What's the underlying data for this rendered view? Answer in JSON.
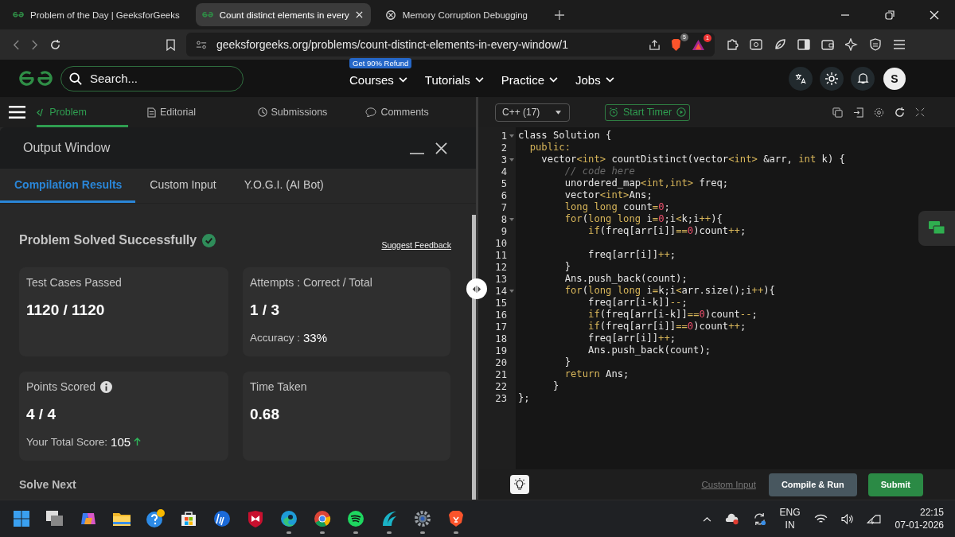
{
  "browser": {
    "tabs": [
      {
        "title": "Problem of the Day | GeeksforGeeks",
        "selected": false
      },
      {
        "title": "Count distinct elements in every",
        "selected": true
      },
      {
        "title": "Memory Corruption Debugging",
        "selected": false
      }
    ],
    "url": "geeksforgeeks.org/problems/count-distinct-elements-in-every-window/1",
    "shield_count": "5",
    "alert_count": "1"
  },
  "site_header": {
    "search": {
      "placeholder": "Search..."
    },
    "promo_badge": "Get 90% Refund",
    "nav": [
      "Courses",
      "Tutorials",
      "Practice",
      "Jobs"
    ],
    "avatar": "S"
  },
  "problem_tabs": [
    {
      "label": "Problem",
      "selected": true
    },
    {
      "label": "Editorial",
      "selected": false
    },
    {
      "label": "Submissions",
      "selected": false
    },
    {
      "label": "Comments",
      "selected": false
    }
  ],
  "output_window": {
    "title": "Output Window",
    "tabs": [
      {
        "label": "Compilation Results",
        "selected": true
      },
      {
        "label": "Custom Input",
        "selected": false
      },
      {
        "label": "Y.O.G.I. (AI Bot)",
        "selected": false
      }
    ],
    "status": "Problem Solved Successfully",
    "feedback_link": "Suggest Feedback",
    "cards": [
      {
        "label": "Test Cases Passed",
        "value": "1120 / 1120"
      },
      {
        "label": "Attempts : Correct / Total",
        "value": "1 / 3",
        "note_label": "Accuracy :",
        "note_value": "33%"
      },
      {
        "label": "Points Scored",
        "info": true,
        "value": "4 / 4",
        "note_label": "Your Total Score:",
        "note_value": "105",
        "trend_up": true
      },
      {
        "label": "Time Taken",
        "value": "0.68"
      }
    ],
    "next_heading": "Solve Next"
  },
  "editor": {
    "language": "C++ (17)",
    "timer_button": "Start Timer",
    "lines": [
      {
        "n": "1",
        "fold": true,
        "tokens": [
          {
            "kind": "plain",
            "text": "class Solution {"
          }
        ]
      },
      {
        "n": "2",
        "fold": false,
        "tokens": [
          {
            "kind": "keyword",
            "text": "  public:"
          }
        ]
      },
      {
        "n": "3",
        "fold": true,
        "tokens": [
          {
            "kind": "plain",
            "text": "    vector"
          },
          {
            "kind": "keyword",
            "text": "<int>"
          },
          {
            "kind": "plain",
            "text": " countDistinct(vector"
          },
          {
            "kind": "keyword",
            "text": "<int>"
          },
          {
            "kind": "plain",
            "text": " &arr, "
          },
          {
            "kind": "keyword",
            "text": "int"
          },
          {
            "kind": "plain",
            "text": " k) {"
          }
        ]
      },
      {
        "n": "4",
        "fold": false,
        "tokens": [
          {
            "kind": "comment",
            "text": "        // code here"
          }
        ]
      },
      {
        "n": "5",
        "fold": false,
        "tokens": [
          {
            "kind": "plain",
            "text": "        unordered_map"
          },
          {
            "kind": "keyword",
            "text": "<int,int>"
          },
          {
            "kind": "plain",
            "text": " freq;"
          }
        ]
      },
      {
        "n": "6",
        "fold": false,
        "tokens": [
          {
            "kind": "plain",
            "text": "        vector"
          },
          {
            "kind": "keyword",
            "text": "<int>"
          },
          {
            "kind": "plain",
            "text": "Ans;"
          }
        ]
      },
      {
        "n": "7",
        "fold": false,
        "tokens": [
          {
            "kind": "keyword",
            "text": "        long long"
          },
          {
            "kind": "plain",
            "text": " count"
          },
          {
            "kind": "keyword",
            "text": "="
          },
          {
            "kind": "number",
            "text": "0"
          },
          {
            "kind": "plain",
            "text": ";"
          }
        ]
      },
      {
        "n": "8",
        "fold": true,
        "tokens": [
          {
            "kind": "keyword",
            "text": "        for"
          },
          {
            "kind": "plain",
            "text": "("
          },
          {
            "kind": "keyword",
            "text": "long long"
          },
          {
            "kind": "plain",
            "text": " i"
          },
          {
            "kind": "keyword",
            "text": "="
          },
          {
            "kind": "number",
            "text": "0"
          },
          {
            "kind": "plain",
            "text": ";i"
          },
          {
            "kind": "keyword",
            "text": "<"
          },
          {
            "kind": "plain",
            "text": "k;i"
          },
          {
            "kind": "keyword",
            "text": "++"
          },
          {
            "kind": "plain",
            "text": "){"
          }
        ]
      },
      {
        "n": "9",
        "fold": false,
        "tokens": [
          {
            "kind": "keyword",
            "text": "            if"
          },
          {
            "kind": "plain",
            "text": "(freq[arr[i]]"
          },
          {
            "kind": "keyword",
            "text": "=="
          },
          {
            "kind": "number",
            "text": "0"
          },
          {
            "kind": "plain",
            "text": ")count"
          },
          {
            "kind": "keyword",
            "text": "++"
          },
          {
            "kind": "plain",
            "text": ";"
          }
        ]
      },
      {
        "n": "10",
        "fold": false
      },
      {
        "n": "11",
        "fold": false,
        "tokens": [
          {
            "kind": "plain",
            "text": "            freq[arr[i]]"
          },
          {
            "kind": "keyword",
            "text": "++"
          },
          {
            "kind": "plain",
            "text": ";"
          }
        ]
      },
      {
        "n": "12",
        "fold": false,
        "tokens": [
          {
            "kind": "plain",
            "text": "        }"
          }
        ]
      },
      {
        "n": "13",
        "fold": false,
        "tokens": [
          {
            "kind": "plain",
            "text": "        Ans.push_back(count);"
          }
        ]
      },
      {
        "n": "14",
        "fold": true,
        "tokens": [
          {
            "kind": "keyword",
            "text": "        for"
          },
          {
            "kind": "plain",
            "text": "("
          },
          {
            "kind": "keyword",
            "text": "long long"
          },
          {
            "kind": "plain",
            "text": " i"
          },
          {
            "kind": "keyword",
            "text": "="
          },
          {
            "kind": "plain",
            "text": "k;i"
          },
          {
            "kind": "keyword",
            "text": "<"
          },
          {
            "kind": "plain",
            "text": "arr.size();i"
          },
          {
            "kind": "keyword",
            "text": "++"
          },
          {
            "kind": "plain",
            "text": "){"
          }
        ]
      },
      {
        "n": "15",
        "fold": false,
        "tokens": [
          {
            "kind": "plain",
            "text": "            freq[arr[i-k]]"
          },
          {
            "kind": "keyword",
            "text": "--"
          },
          {
            "kind": "plain",
            "text": ";"
          }
        ]
      },
      {
        "n": "16",
        "fold": false,
        "tokens": [
          {
            "kind": "keyword",
            "text": "            if"
          },
          {
            "kind": "plain",
            "text": "(freq[arr[i-k]]"
          },
          {
            "kind": "keyword",
            "text": "=="
          },
          {
            "kind": "number",
            "text": "0"
          },
          {
            "kind": "plain",
            "text": ")count"
          },
          {
            "kind": "keyword",
            "text": "--"
          },
          {
            "kind": "plain",
            "text": ";"
          }
        ]
      },
      {
        "n": "17",
        "fold": false,
        "tokens": [
          {
            "kind": "keyword",
            "text": "            if"
          },
          {
            "kind": "plain",
            "text": "(freq[arr[i]]"
          },
          {
            "kind": "keyword",
            "text": "=="
          },
          {
            "kind": "number",
            "text": "0"
          },
          {
            "kind": "plain",
            "text": ")count"
          },
          {
            "kind": "keyword",
            "text": "++"
          },
          {
            "kind": "plain",
            "text": ";"
          }
        ]
      },
      {
        "n": "18",
        "fold": false,
        "tokens": [
          {
            "kind": "plain",
            "text": "            freq[arr[i]]"
          },
          {
            "kind": "keyword",
            "text": "++"
          },
          {
            "kind": "plain",
            "text": ";"
          }
        ]
      },
      {
        "n": "19",
        "fold": false,
        "tokens": [
          {
            "kind": "plain",
            "text": "            Ans.push_back(count);"
          }
        ]
      },
      {
        "n": "20",
        "fold": false,
        "tokens": [
          {
            "kind": "plain",
            "text": "        }"
          }
        ]
      },
      {
        "n": "21",
        "fold": false,
        "tokens": [
          {
            "kind": "keyword",
            "text": "        return"
          },
          {
            "kind": "plain",
            "text": " Ans;"
          }
        ]
      },
      {
        "n": "22",
        "fold": false,
        "tokens": [
          {
            "kind": "plain",
            "text": "      }"
          }
        ]
      },
      {
        "n": "23",
        "fold": false,
        "tokens": [
          {
            "kind": "plain",
            "text": "};"
          }
        ]
      }
    ],
    "custom_input_link": "Custom Input",
    "compile_button": "Compile & Run",
    "submit_button": "Submit"
  },
  "taskbar": {
    "apps": [
      {
        "kind": "start",
        "running": false
      },
      {
        "kind": "taskview",
        "running": false
      },
      {
        "kind": "copilot",
        "running": false
      },
      {
        "kind": "folder",
        "running": false
      },
      {
        "kind": "help",
        "running": false
      },
      {
        "kind": "store",
        "running": false
      },
      {
        "kind": "hp",
        "running": false
      },
      {
        "kind": "shield",
        "running": false
      },
      {
        "kind": "edge",
        "running": true
      },
      {
        "kind": "chrome",
        "running": true
      },
      {
        "kind": "spotify",
        "running": true
      },
      {
        "kind": "wave",
        "running": true
      },
      {
        "kind": "settings",
        "running": true
      },
      {
        "kind": "brave",
        "running": true
      }
    ],
    "language": "ENG",
    "region": "IN",
    "time": "22:15",
    "date": "07-01-2026"
  }
}
